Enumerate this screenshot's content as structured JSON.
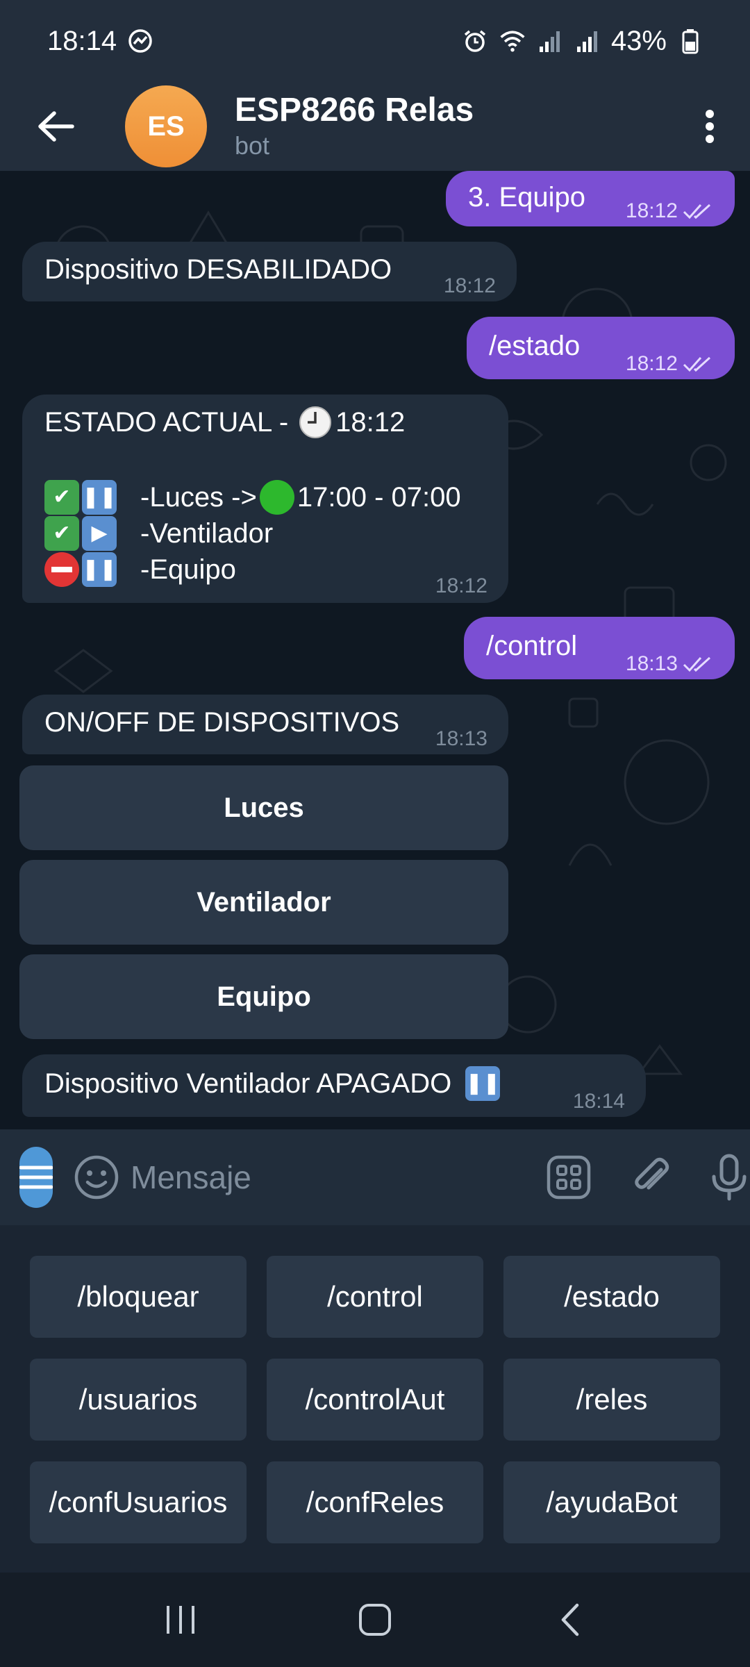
{
  "status_bar": {
    "time": "18:14",
    "battery": "43%"
  },
  "header": {
    "avatar_initials": "ES",
    "title": "ESP8266 Relas",
    "subtitle": "bot"
  },
  "messages": {
    "m1": {
      "text": "3. Equipo",
      "time": "18:12"
    },
    "m2": {
      "text": "Dispositivo DESABILIDADO",
      "time": "18:12"
    },
    "m3": {
      "text": "/estado",
      "time": "18:12"
    },
    "m4": {
      "title_prefix": "ESTADO ACTUAL - ",
      "title_time": "18:12",
      "line1_label": "-Luces -> ",
      "line1_range": "17:00 - 07:00",
      "line2_label": "-Ventilador",
      "line3_label": "-Equipo",
      "time": "18:12"
    },
    "m5": {
      "text": "/control",
      "time": "18:13"
    },
    "m6": {
      "text": "ON/OFF DE DISPOSITIVOS",
      "time": "18:13"
    },
    "inline_buttons": [
      "Luces",
      "Ventilador",
      "Equipo"
    ],
    "m7": {
      "text": "Dispositivo Ventilador APAGADO",
      "time": "18:14"
    }
  },
  "input": {
    "placeholder": "Mensaje"
  },
  "keyboard": {
    "rows": [
      [
        "/bloquear",
        "/control",
        "/estado"
      ],
      [
        "/usuarios",
        "/controlAut",
        "/reles"
      ],
      [
        "/confUsuarios",
        "/confReles",
        "/ayudaBot"
      ]
    ]
  },
  "colors": {
    "outgoing": "#7b4fd3",
    "incoming": "#212d3b",
    "accent": "#4f98d7",
    "avatar": "#f0993e"
  }
}
